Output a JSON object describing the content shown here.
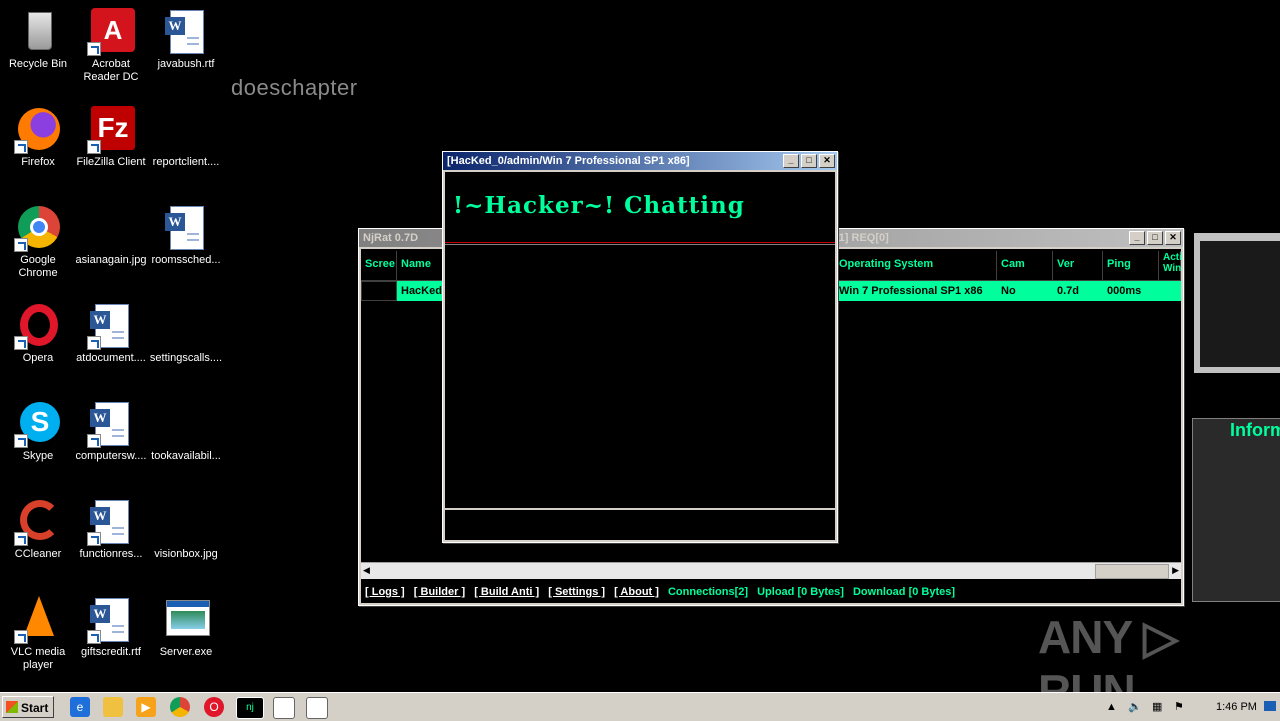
{
  "desktop": {
    "icons": [
      {
        "label": "Recycle Bin"
      },
      {
        "label": "Acrobat Reader DC"
      },
      {
        "label": "javabush.rtf"
      },
      {
        "label": "Firefox"
      },
      {
        "label": "FileZilla Client"
      },
      {
        "label": "reportclient...."
      },
      {
        "label": "Google Chrome"
      },
      {
        "label": "asianagain.jpg"
      },
      {
        "label": "roomssched..."
      },
      {
        "label": "Opera"
      },
      {
        "label": "atdocument...."
      },
      {
        "label": "settingscalls...."
      },
      {
        "label": "Skype"
      },
      {
        "label": "computersw...."
      },
      {
        "label": "tookavailabil..."
      },
      {
        "label": "CCleaner"
      },
      {
        "label": "functionres..."
      },
      {
        "label": "visionbox.jpg"
      },
      {
        "label": "VLC media player"
      },
      {
        "label": "giftscredit.rtf"
      },
      {
        "label": "Server.exe"
      }
    ],
    "floating_text": "doeschapter"
  },
  "njrat": {
    "title": "NjRat 0.7D",
    "title_right": "[1] REQ[0]",
    "columns": [
      "Scree",
      "Name",
      "Operating System",
      "Cam",
      "Ver",
      "Ping",
      "Acti Win"
    ],
    "row": {
      "name": "HacKed",
      "os": "Win 7 Professional SP1 x86",
      "cam": "No",
      "ver": "0.7d",
      "ping": "000ms"
    },
    "links": [
      "[ Logs ]",
      "[ Builder ]",
      "[ Build Anti ]",
      "[ Settings ]",
      "[ About ]"
    ],
    "status": {
      "connections": "Connections[2]",
      "upload": "Upload [0 Bytes]",
      "download": "Download [0 Bytes]"
    }
  },
  "chat": {
    "title": "[HacKed_0/admin/Win 7 Professional SP1 x86]",
    "header": "!~Hacker~! Chatting"
  },
  "right_panel": {
    "label": "Inform"
  },
  "taskbar": {
    "start": "Start",
    "clock": "1:46 PM"
  },
  "watermark": "ANY RUN",
  "colors": {
    "accent": "#00ff9c",
    "desktop": "#000000"
  }
}
